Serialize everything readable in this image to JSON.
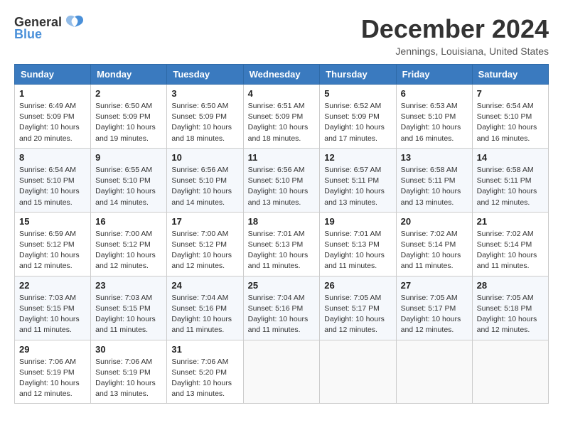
{
  "logo": {
    "line1": "General",
    "line2": "Blue"
  },
  "title": "December 2024",
  "location": "Jennings, Louisiana, United States",
  "days_header": [
    "Sunday",
    "Monday",
    "Tuesday",
    "Wednesday",
    "Thursday",
    "Friday",
    "Saturday"
  ],
  "weeks": [
    [
      {
        "day": "1",
        "info": "Sunrise: 6:49 AM\nSunset: 5:09 PM\nDaylight: 10 hours\nand 20 minutes."
      },
      {
        "day": "2",
        "info": "Sunrise: 6:50 AM\nSunset: 5:09 PM\nDaylight: 10 hours\nand 19 minutes."
      },
      {
        "day": "3",
        "info": "Sunrise: 6:50 AM\nSunset: 5:09 PM\nDaylight: 10 hours\nand 18 minutes."
      },
      {
        "day": "4",
        "info": "Sunrise: 6:51 AM\nSunset: 5:09 PM\nDaylight: 10 hours\nand 18 minutes."
      },
      {
        "day": "5",
        "info": "Sunrise: 6:52 AM\nSunset: 5:09 PM\nDaylight: 10 hours\nand 17 minutes."
      },
      {
        "day": "6",
        "info": "Sunrise: 6:53 AM\nSunset: 5:10 PM\nDaylight: 10 hours\nand 16 minutes."
      },
      {
        "day": "7",
        "info": "Sunrise: 6:54 AM\nSunset: 5:10 PM\nDaylight: 10 hours\nand 16 minutes."
      }
    ],
    [
      {
        "day": "8",
        "info": "Sunrise: 6:54 AM\nSunset: 5:10 PM\nDaylight: 10 hours\nand 15 minutes."
      },
      {
        "day": "9",
        "info": "Sunrise: 6:55 AM\nSunset: 5:10 PM\nDaylight: 10 hours\nand 14 minutes."
      },
      {
        "day": "10",
        "info": "Sunrise: 6:56 AM\nSunset: 5:10 PM\nDaylight: 10 hours\nand 14 minutes."
      },
      {
        "day": "11",
        "info": "Sunrise: 6:56 AM\nSunset: 5:10 PM\nDaylight: 10 hours\nand 13 minutes."
      },
      {
        "day": "12",
        "info": "Sunrise: 6:57 AM\nSunset: 5:11 PM\nDaylight: 10 hours\nand 13 minutes."
      },
      {
        "day": "13",
        "info": "Sunrise: 6:58 AM\nSunset: 5:11 PM\nDaylight: 10 hours\nand 13 minutes."
      },
      {
        "day": "14",
        "info": "Sunrise: 6:58 AM\nSunset: 5:11 PM\nDaylight: 10 hours\nand 12 minutes."
      }
    ],
    [
      {
        "day": "15",
        "info": "Sunrise: 6:59 AM\nSunset: 5:12 PM\nDaylight: 10 hours\nand 12 minutes."
      },
      {
        "day": "16",
        "info": "Sunrise: 7:00 AM\nSunset: 5:12 PM\nDaylight: 10 hours\nand 12 minutes."
      },
      {
        "day": "17",
        "info": "Sunrise: 7:00 AM\nSunset: 5:12 PM\nDaylight: 10 hours\nand 12 minutes."
      },
      {
        "day": "18",
        "info": "Sunrise: 7:01 AM\nSunset: 5:13 PM\nDaylight: 10 hours\nand 11 minutes."
      },
      {
        "day": "19",
        "info": "Sunrise: 7:01 AM\nSunset: 5:13 PM\nDaylight: 10 hours\nand 11 minutes."
      },
      {
        "day": "20",
        "info": "Sunrise: 7:02 AM\nSunset: 5:14 PM\nDaylight: 10 hours\nand 11 minutes."
      },
      {
        "day": "21",
        "info": "Sunrise: 7:02 AM\nSunset: 5:14 PM\nDaylight: 10 hours\nand 11 minutes."
      }
    ],
    [
      {
        "day": "22",
        "info": "Sunrise: 7:03 AM\nSunset: 5:15 PM\nDaylight: 10 hours\nand 11 minutes."
      },
      {
        "day": "23",
        "info": "Sunrise: 7:03 AM\nSunset: 5:15 PM\nDaylight: 10 hours\nand 11 minutes."
      },
      {
        "day": "24",
        "info": "Sunrise: 7:04 AM\nSunset: 5:16 PM\nDaylight: 10 hours\nand 11 minutes."
      },
      {
        "day": "25",
        "info": "Sunrise: 7:04 AM\nSunset: 5:16 PM\nDaylight: 10 hours\nand 11 minutes."
      },
      {
        "day": "26",
        "info": "Sunrise: 7:05 AM\nSunset: 5:17 PM\nDaylight: 10 hours\nand 12 minutes."
      },
      {
        "day": "27",
        "info": "Sunrise: 7:05 AM\nSunset: 5:17 PM\nDaylight: 10 hours\nand 12 minutes."
      },
      {
        "day": "28",
        "info": "Sunrise: 7:05 AM\nSunset: 5:18 PM\nDaylight: 10 hours\nand 12 minutes."
      }
    ],
    [
      {
        "day": "29",
        "info": "Sunrise: 7:06 AM\nSunset: 5:19 PM\nDaylight: 10 hours\nand 12 minutes."
      },
      {
        "day": "30",
        "info": "Sunrise: 7:06 AM\nSunset: 5:19 PM\nDaylight: 10 hours\nand 13 minutes."
      },
      {
        "day": "31",
        "info": "Sunrise: 7:06 AM\nSunset: 5:20 PM\nDaylight: 10 hours\nand 13 minutes."
      },
      {
        "day": "",
        "info": ""
      },
      {
        "day": "",
        "info": ""
      },
      {
        "day": "",
        "info": ""
      },
      {
        "day": "",
        "info": ""
      }
    ]
  ]
}
